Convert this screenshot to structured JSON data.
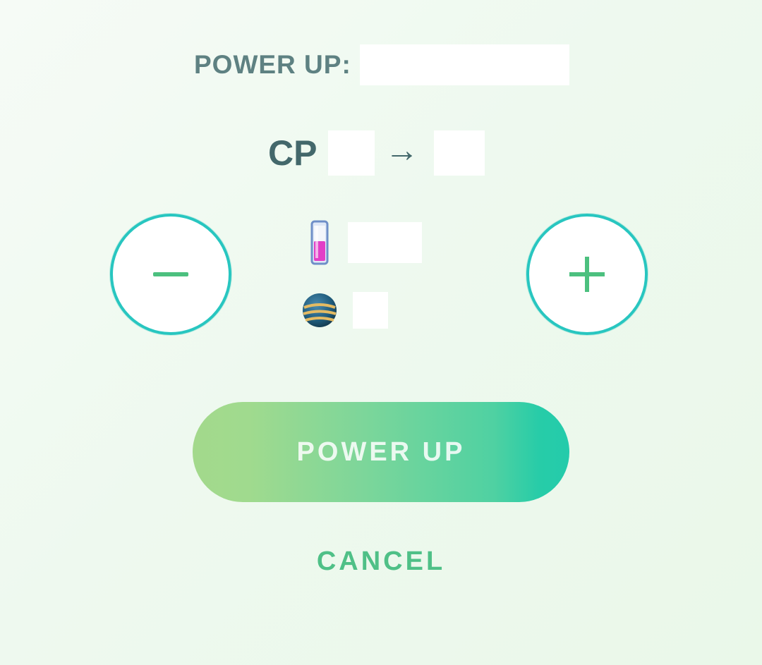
{
  "dialog": {
    "title": "POWER UP:",
    "cp_label": "CP",
    "cp_arrow": "→"
  },
  "controls": {
    "minus_icon": "minus-icon",
    "plus_icon": "plus-icon"
  },
  "costs": {
    "candy_icon": "rare-candy-vial-icon",
    "stardust_icon": "stardust-orb-icon"
  },
  "actions": {
    "power_up_label": "POWER UP",
    "cancel_label": "CANCEL"
  },
  "colors": {
    "accent_green": "#4cc07f",
    "ring_teal": "#28c6c0",
    "title_gray": "#5e8182"
  }
}
